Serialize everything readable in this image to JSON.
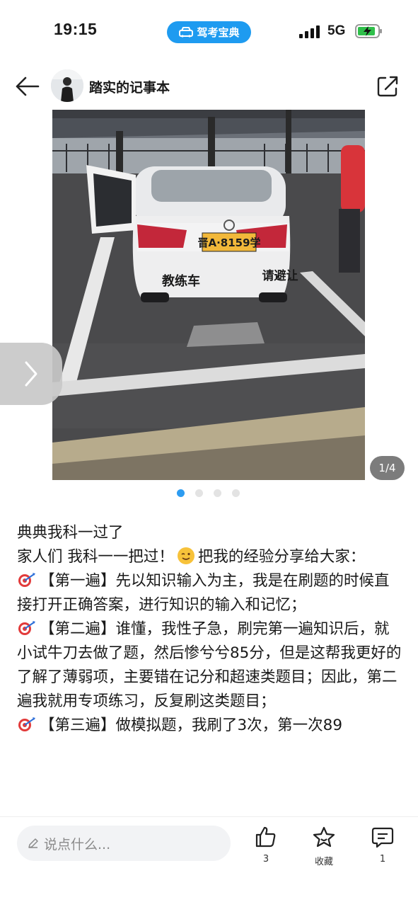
{
  "status_bar": {
    "time": "19:15",
    "app_badge": "驾考宝典",
    "network": "5G",
    "icons": [
      "signal-icon",
      "battery-charging-icon",
      "car-icon"
    ]
  },
  "header": {
    "author": "踏实的记事本",
    "icons": [
      "back-arrow-icon",
      "share-icon"
    ]
  },
  "photo": {
    "page_indicator": "1/4",
    "plate": "晋A·8159学",
    "car_text_left": "教练车",
    "car_text_right": "请避让",
    "dots_total": 4,
    "dots_active": 0
  },
  "post": {
    "title": "典典我科一过了",
    "intro_before": "家人们 我科一一把过！",
    "intro_after": "把我的经验分享给大家：",
    "para1": "【第一遍】先以知识输入为主，我是在刷题的时候直接打开正确答案，进行知识的输入和记忆；",
    "para2": "【第二遍】谁懂，我性子急，刷完第一遍知识后，就小试牛刀去做了题，然后惨兮兮85分，但是这帮我更好的了解了薄弱项，主要错在记分和超速类题目；因此，第二遍我就用专项练习，反复刷这类题目；",
    "para3": "【第三遍】做模拟题，我刷了3次，第一次89"
  },
  "bottom_bar": {
    "comment_placeholder": "说点什么...",
    "like_count": "3",
    "collect_label": "收藏",
    "comment_count": "1",
    "accent": "#2d9cf1"
  }
}
